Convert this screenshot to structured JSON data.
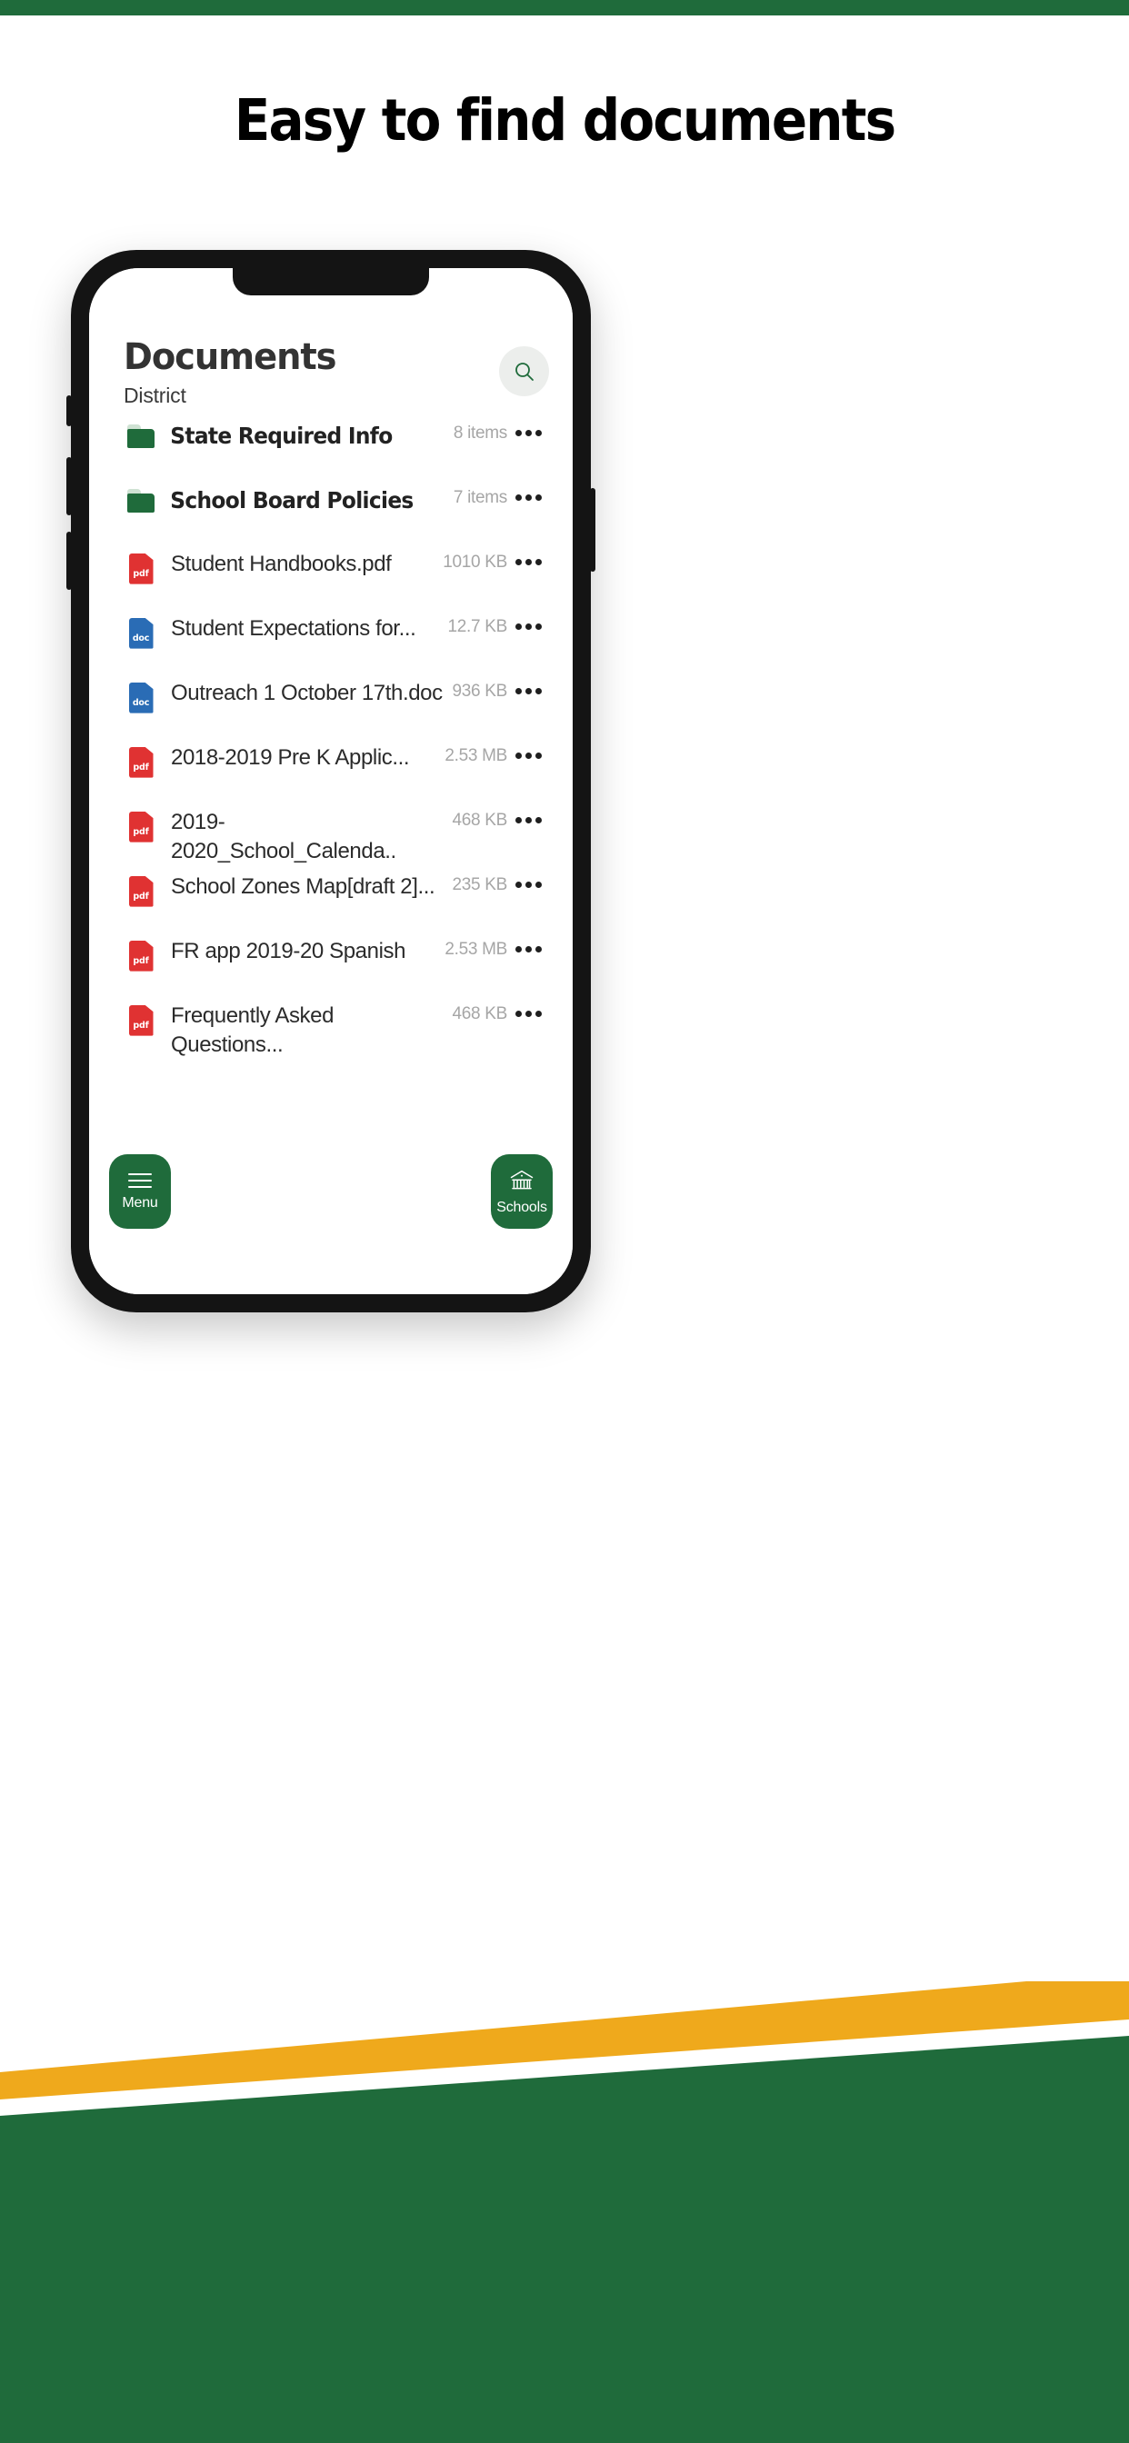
{
  "headline": "Easy to find documents",
  "colors": {
    "brand_green": "#1f6b3b",
    "accent_yellow": "#efa91c",
    "pdf_red": "#e03232",
    "doc_blue": "#2a6cb5",
    "title_gray": "#333333",
    "meta_gray": "#a6a6a6"
  },
  "app": {
    "title": "Documents",
    "subtitle": "District",
    "search": {
      "icon": "search-icon"
    },
    "items": [
      {
        "kind": "folder",
        "icon": "folder-icon",
        "name": "State Required Info",
        "meta": "8 items"
      },
      {
        "kind": "folder",
        "icon": "folder-icon",
        "name": "School Board Policies",
        "meta": "7 items"
      },
      {
        "kind": "file",
        "icon": "pdf-file-icon",
        "badge": "pdf",
        "name": "Student Handbooks.pdf",
        "meta": "1010 KB"
      },
      {
        "kind": "file",
        "icon": "doc-file-icon",
        "badge": "doc",
        "name": "Student Expectations for...",
        "meta": "12.7 KB"
      },
      {
        "kind": "file",
        "icon": "doc-file-icon",
        "badge": "doc",
        "name": "Outreach 1 October 17th.doc",
        "meta": "936 KB"
      },
      {
        "kind": "file",
        "icon": "pdf-file-icon",
        "badge": "pdf",
        "name": "2018-2019 Pre K Applic...",
        "meta": "2.53 MB"
      },
      {
        "kind": "file",
        "icon": "pdf-file-icon",
        "badge": "pdf",
        "name": "2019-2020_School_Calenda..",
        "meta": "468 KB"
      },
      {
        "kind": "file",
        "icon": "pdf-file-icon",
        "badge": "pdf",
        "name": "School Zones Map[draft 2]...",
        "meta": "235 KB"
      },
      {
        "kind": "file",
        "icon": "pdf-file-icon",
        "badge": "pdf",
        "name": "FR app 2019-20 Spanish",
        "meta": "2.53 MB"
      },
      {
        "kind": "file",
        "icon": "pdf-file-icon",
        "badge": "pdf",
        "name": "Frequently Asked Questions...",
        "meta": "468 KB"
      }
    ],
    "bottom_nav": [
      {
        "icon": "hamburger-menu-icon",
        "label": "Menu"
      },
      {
        "icon": "school-building-icon",
        "label": "Schools"
      }
    ]
  }
}
